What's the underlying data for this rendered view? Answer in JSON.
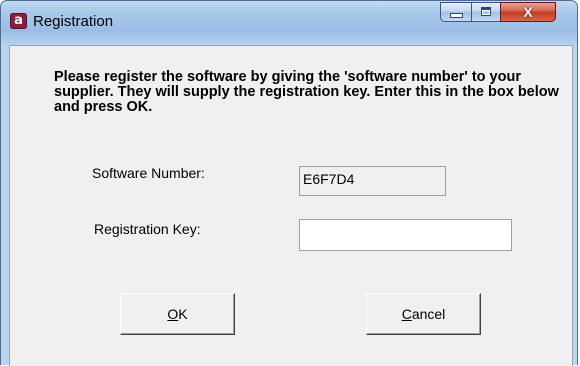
{
  "window": {
    "title": "Registration",
    "icon": "app-logo-icon",
    "icon_letter": "a",
    "buttons": {
      "minimize": "minimize-icon",
      "maximize": "maximize-icon",
      "close_glyph": "X"
    }
  },
  "dialog": {
    "instructions": "Please register the software by giving the 'software number' to your supplier. They will supply the registration key. Enter this in the box below and press OK.",
    "software_number_label": "Software Number:",
    "software_number_value": "E6F7D4",
    "registration_key_label": "Registration Key:",
    "registration_key_value": "",
    "ok_mnemonic": "O",
    "ok_rest": "K",
    "cancel_mnemonic": "C",
    "cancel_rest": "ancel"
  },
  "colors": {
    "frame": "#bcd5ef",
    "client_bg": "#f0f0f0",
    "close_button": "#c23a22"
  }
}
